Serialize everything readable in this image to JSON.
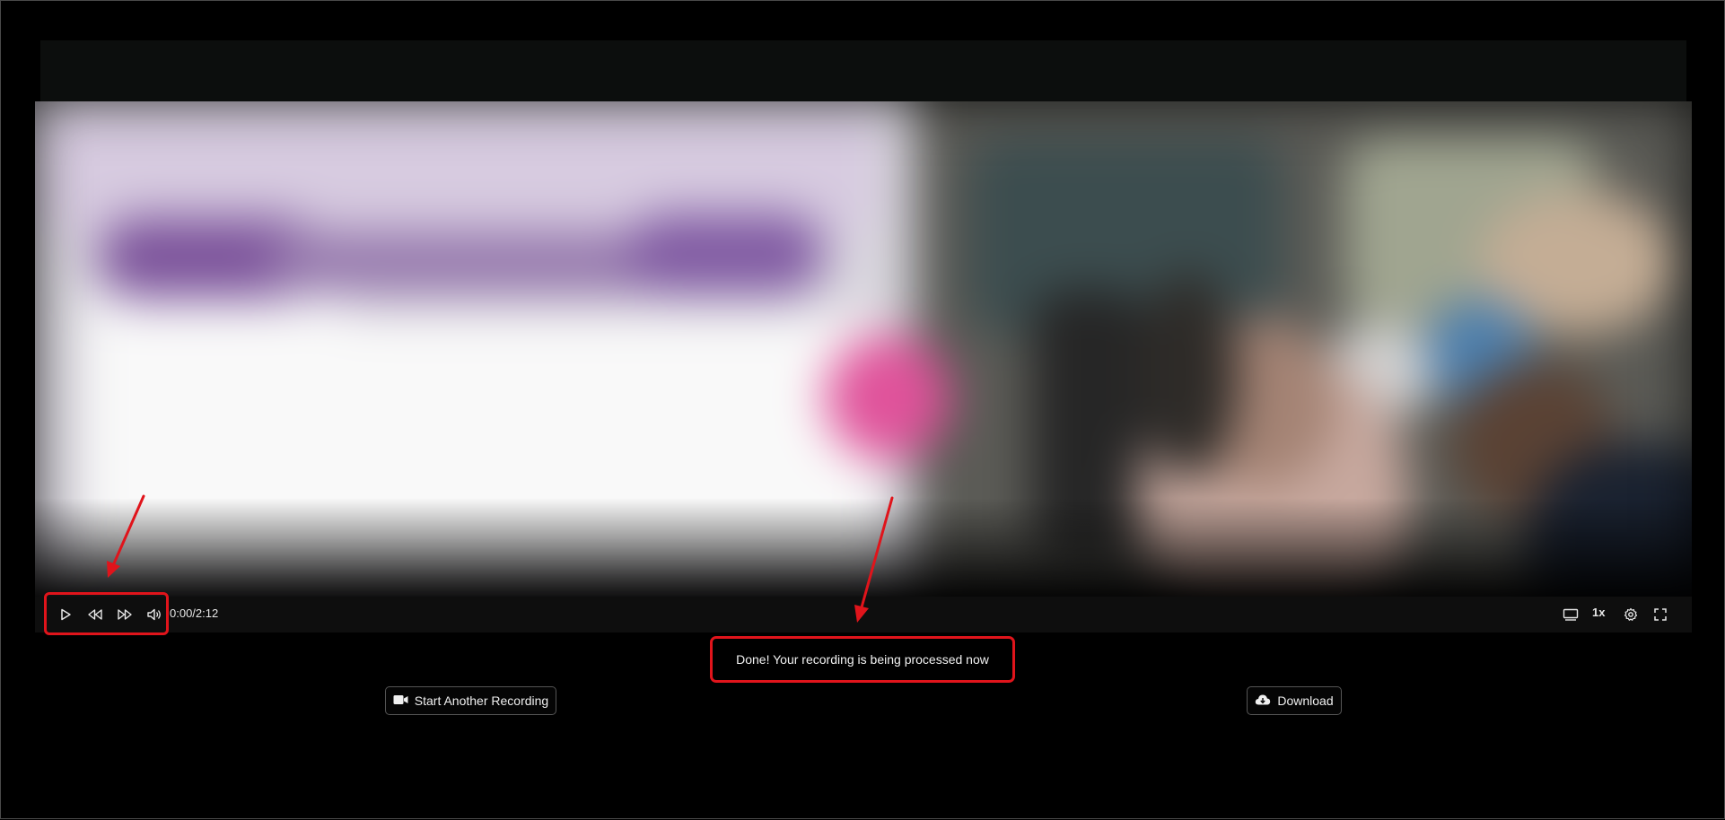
{
  "player": {
    "time_display": "0:00/2:12",
    "speed_label": "1x",
    "controls": {
      "play_icon": "play-icon",
      "rewind_icon": "rewind-icon",
      "forward_icon": "fast-forward-icon",
      "volume_icon": "volume-icon",
      "captions_icon": "captions-icon",
      "settings_icon": "gear-icon",
      "fullscreen_icon": "fullscreen-icon"
    }
  },
  "status": {
    "message": "Done! Your recording is being processed now"
  },
  "actions": {
    "start_another_label": "Start Another Recording",
    "start_another_icon": "video-camera-icon",
    "download_label": "Download",
    "download_icon": "cloud-download-icon"
  },
  "annotations": {
    "color": "#e0141b"
  }
}
